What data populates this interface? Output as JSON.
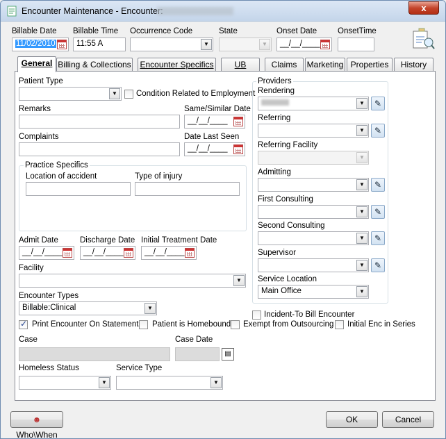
{
  "window": {
    "title": "Encounter Maintenance - Encounter:",
    "close_label": "x"
  },
  "header": {
    "billable_date_label": "Billable Date",
    "billable_date_value": "11/02/2010",
    "billable_time_label": "Billable Time",
    "billable_time_value": "11:55 A",
    "occurrence_code_label": "Occurrence Code",
    "state_label": "State",
    "onset_date_label": "Onset Date",
    "onset_date_value": "__/__/____",
    "onset_time_label": "OnsetTime"
  },
  "tabs": [
    {
      "label": "General",
      "active": true
    },
    {
      "label": "Billing & Collections"
    },
    {
      "label": "Encounter Specifics"
    },
    {
      "label": "UB"
    },
    {
      "label": "Claims"
    },
    {
      "label": "Marketing"
    },
    {
      "label": "Properties"
    },
    {
      "label": "History"
    }
  ],
  "general": {
    "patient_type_label": "Patient Type",
    "condition_employment_label": "Condition Related to Employment",
    "remarks_label": "Remarks",
    "same_similar_date_label": "Same/Similar Date",
    "complaints_label": "Complaints",
    "date_last_seen_label": "Date Last Seen",
    "empty_date": "__/__/____",
    "practice_specifics_label": "Practice Specifics",
    "location_accident_label": "Location of accident",
    "type_injury_label": "Type of injury",
    "admit_date_label": "Admit Date",
    "discharge_date_label": "Discharge Date",
    "initial_treatment_label": "Initial Treatment Date",
    "facility_label": "Facility",
    "encounter_types_label": "Encounter Types",
    "encounter_types_value": "Billable:Clinical",
    "print_encounter_label": "Print Encounter On Statements",
    "print_encounter_checked": true,
    "homebound_label": "Patient is Homebound",
    "exempt_label": "Exempt from Outsourcing",
    "initial_enc_label": "Initial Enc in Series",
    "incident_to_label": "Incident-To Bill Encounter",
    "case_label": "Case",
    "case_date_label": "Case Date",
    "homeless_label": "Homeless Status",
    "service_type_label": "Service Type"
  },
  "providers": {
    "group_label": "Providers",
    "rendering_label": "Rendering",
    "referring_label": "Referring",
    "referring_facility_label": "Referring Facility",
    "admitting_label": "Admitting",
    "first_consulting_label": "First Consulting",
    "second_consulting_label": "Second Consulting",
    "supervisor_label": "Supervisor",
    "service_location_label": "Service Location",
    "service_location_value": "Main Office"
  },
  "footer": {
    "who_when_label": "Who\\When",
    "ok_label": "OK",
    "cancel_label": "Cancel"
  },
  "icons": {
    "pen": "pen-icon",
    "calendar": "calendar-icon",
    "dropdown": "chevron-down-icon"
  }
}
